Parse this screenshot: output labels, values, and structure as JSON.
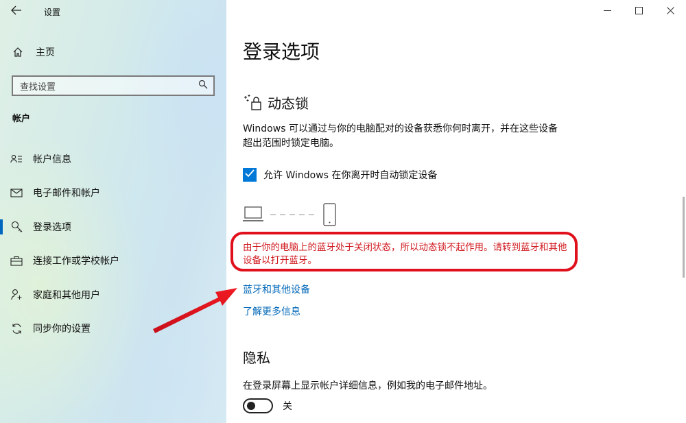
{
  "window": {
    "title": "设置",
    "back_icon": "back-arrow-icon",
    "controls": {
      "minimize": "—",
      "maximize": "☐",
      "close": "✕"
    }
  },
  "sidebar": {
    "home_label": "主页",
    "search_placeholder": "查找设置",
    "section_title": "帐户",
    "items": [
      {
        "label": "帐户信息",
        "icon": "account-info-icon",
        "active": false
      },
      {
        "label": "电子邮件和帐户",
        "icon": "mail-icon",
        "active": false
      },
      {
        "label": "登录选项",
        "icon": "key-icon",
        "active": true
      },
      {
        "label": "连接工作或学校帐户",
        "icon": "briefcase-icon",
        "active": false
      },
      {
        "label": "家庭和其他用户",
        "icon": "person-add-icon",
        "active": false
      },
      {
        "label": "同步你的设置",
        "icon": "sync-icon",
        "active": false
      }
    ]
  },
  "main": {
    "page_title": "登录选项",
    "dynamic_lock": {
      "heading": "动态锁",
      "description": "Windows 可以通过与你的电脑配对的设备获悉你何时离开，并在这些设备超出范围时锁定电脑。",
      "checkbox_label": "允许 Windows 在你离开时自动锁定设备",
      "checkbox_checked": true,
      "warning": "由于你的电脑上的蓝牙处于关闭状态，所以动态锁不起作用。请转到蓝牙和其他设备以打开蓝牙。",
      "link_bluetooth": "蓝牙和其他设备",
      "link_more": "了解更多信息"
    },
    "privacy": {
      "heading": "隐私",
      "description": "在登录屏幕上显示帐户详细信息，例如我的电子邮件地址。",
      "toggle_state": "关",
      "toggle_on": false
    }
  },
  "colors": {
    "accent": "#0078d7",
    "link": "#0067b8",
    "warning_text": "#d0181e",
    "annotation_red": "#e0101c"
  }
}
